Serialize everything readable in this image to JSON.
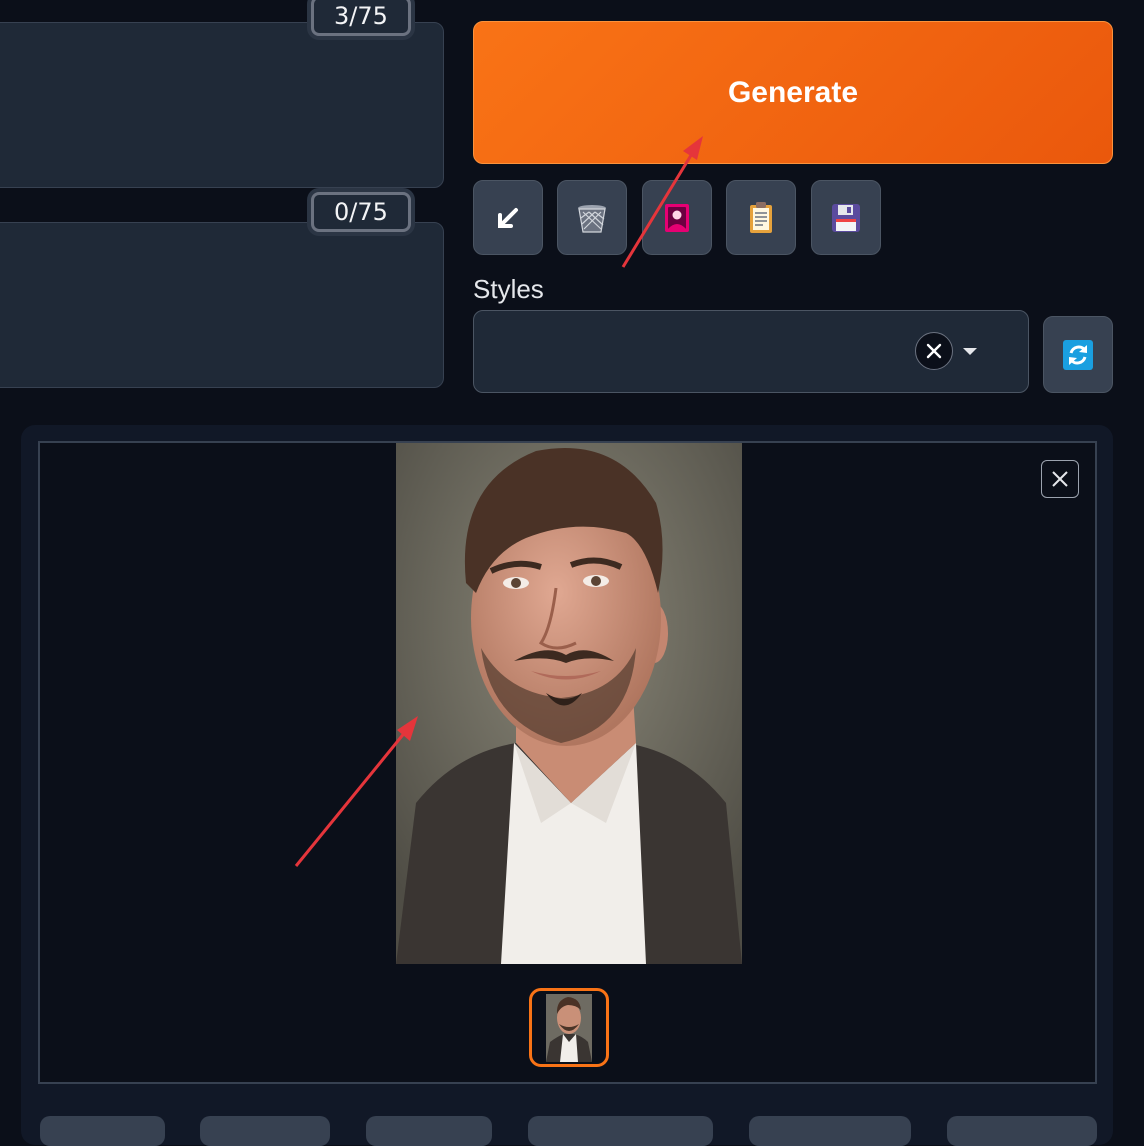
{
  "prompt": {
    "token_count": "3/75"
  },
  "negative_prompt": {
    "token_count": "0/75"
  },
  "generate_button": {
    "label": "Generate"
  },
  "toolbar": {
    "buttons": [
      {
        "icon": "arrow-down-left-icon"
      },
      {
        "icon": "trash-icon"
      },
      {
        "icon": "picture-card-icon"
      },
      {
        "icon": "clipboard-icon"
      },
      {
        "icon": "floppy-save-icon"
      }
    ]
  },
  "styles": {
    "label": "Styles"
  },
  "colors": {
    "accent": "#f97316",
    "background": "#0b0f19",
    "arrow": "#e5353b"
  }
}
